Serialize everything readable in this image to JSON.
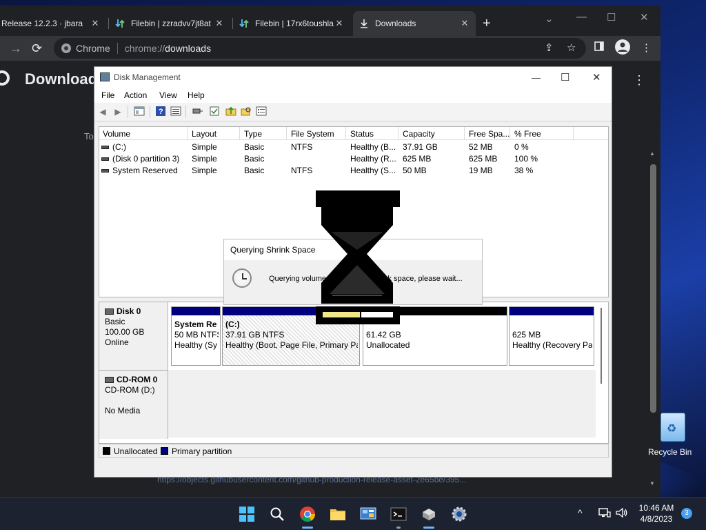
{
  "browser": {
    "tabs": [
      {
        "title": "Release 12.2.3 · jbara",
        "icon": "github-icon"
      },
      {
        "title": "Filebin | zzradvv7jt8at",
        "icon": "filebin-icon"
      },
      {
        "title": "Filebin | 17rx6toushla",
        "icon": "filebin-icon"
      },
      {
        "title": "Downloads",
        "icon": "download-icon",
        "active": true
      }
    ],
    "omnibox": {
      "site_label": "Chrome",
      "url_scheme": "chrome://",
      "url_host": "downloads"
    }
  },
  "downloads_page": {
    "title": "Downloads",
    "partial_text": "To",
    "faded_url": "https://objects.githubusercontent.com/github-production-release-asset-2e65be/395..."
  },
  "disk_mgmt": {
    "title": "Disk Management",
    "menu": [
      "File",
      "Action",
      "View",
      "Help"
    ],
    "columns": [
      "Volume",
      "Layout",
      "Type",
      "File System",
      "Status",
      "Capacity",
      "Free Spa...",
      "% Free"
    ],
    "volumes": [
      {
        "volume": "(C:)",
        "layout": "Simple",
        "type": "Basic",
        "fs": "NTFS",
        "status": "Healthy (B...",
        "capacity": "37.91 GB",
        "free": "52 MB",
        "pct": "0 %"
      },
      {
        "volume": "(Disk 0 partition 3)",
        "layout": "Simple",
        "type": "Basic",
        "fs": "",
        "status": "Healthy (R...",
        "capacity": "625 MB",
        "free": "625 MB",
        "pct": "100 %"
      },
      {
        "volume": "System Reserved",
        "layout": "Simple",
        "type": "Basic",
        "fs": "NTFS",
        "status": "Healthy (S...",
        "capacity": "50 MB",
        "free": "19 MB",
        "pct": "38 %"
      }
    ],
    "disk0": {
      "name": "Disk 0",
      "type": "Basic",
      "size": "100.00 GB",
      "state": "Online",
      "partitions": [
        {
          "name": "System Re",
          "size": "50 MB NTFS",
          "status": "Healthy (Sy"
        },
        {
          "name": "(C:)",
          "size": "37.91 GB NTFS",
          "status": "Healthy (Boot, Page File, Primary Pa"
        },
        {
          "name": "",
          "size": "61.42 GB",
          "status": "Unallocated"
        },
        {
          "name": "",
          "size": "625 MB",
          "status": "Healthy (Recovery Pa"
        }
      ]
    },
    "cdrom": {
      "name": "CD-ROM 0",
      "drive": "CD-ROM (D:)",
      "media": "No Media"
    },
    "legend": [
      "Unallocated",
      "Primary partition"
    ],
    "colors": {
      "primary": "#00007f",
      "unallocated": "#000000"
    }
  },
  "shrink_dialog": {
    "title": "Querying Shrink Space",
    "message": "Querying volume for available shrink space, please wait..."
  },
  "desktop": {
    "recycle_bin_label": "Recycle Bin"
  },
  "taskbar": {
    "time": "10:46 AM",
    "date": "4/8/2023",
    "notification_count": "3"
  }
}
